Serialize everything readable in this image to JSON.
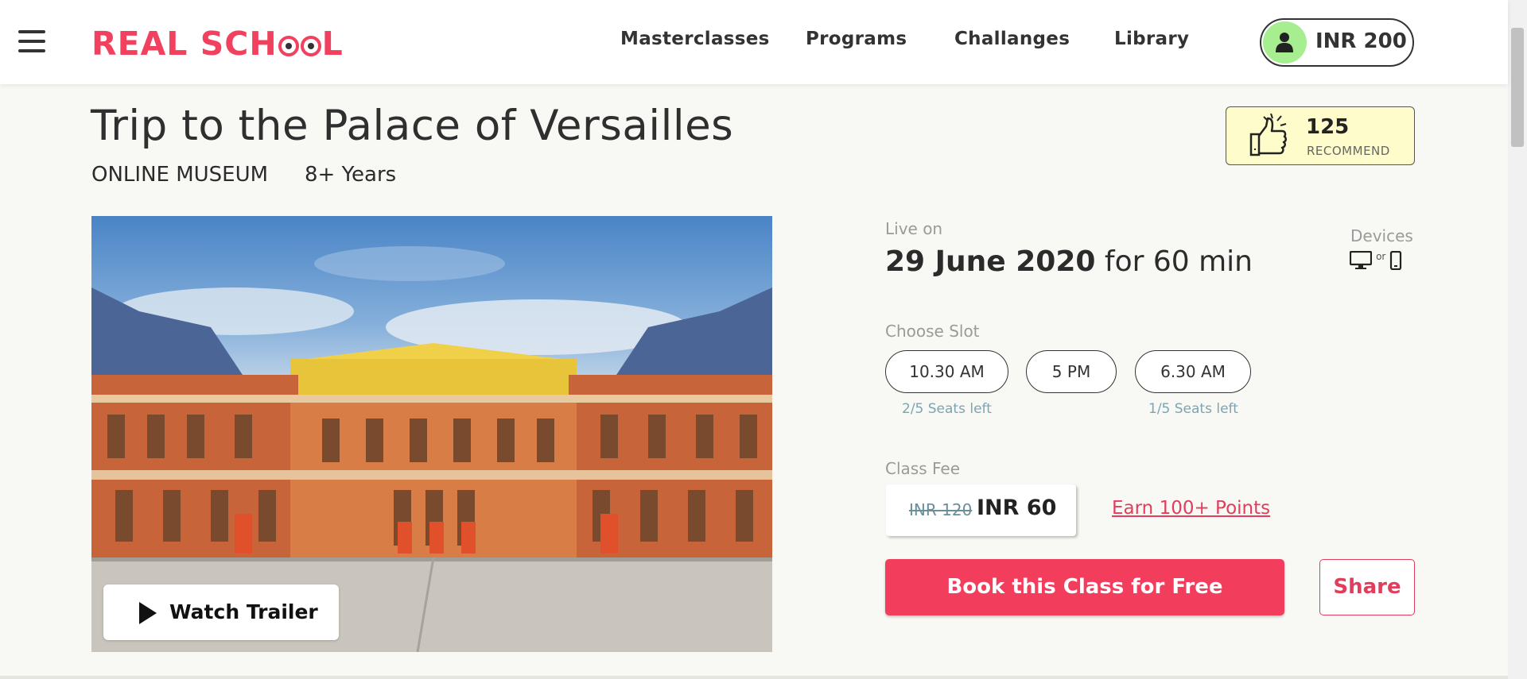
{
  "header": {
    "logo_text_a": "REAL SCH",
    "logo_text_b": "L",
    "nav": [
      "Masterclasses",
      "Programs",
      "Challanges",
      "Library"
    ],
    "wallet_amount": "INR 200"
  },
  "class": {
    "title": "Trip to the Palace of Versailles",
    "category": "ONLINE MUSEUM",
    "age": "8+ Years",
    "recommend_count": "125",
    "recommend_label": "RECOMMEND",
    "trailer_label": "Watch Trailer"
  },
  "schedule": {
    "live_label": "Live on",
    "date": "29 June 2020",
    "duration": "for 60 min",
    "devices_label": "Devices",
    "devices_or": "or",
    "slot_label": "Choose Slot",
    "slots": [
      {
        "time": "10.30 AM",
        "seats": "2/5 Seats left"
      },
      {
        "time": "5 PM",
        "seats": ""
      },
      {
        "time": "6.30 AM",
        "seats": "1/5 Seats left"
      }
    ]
  },
  "fee": {
    "label": "Class Fee",
    "original": "INR 120",
    "price": "INR 60",
    "earn_link": "Earn 100+ Points"
  },
  "actions": {
    "book": "Book this Class for Free",
    "share": "Share"
  },
  "colors": {
    "accent": "#f23d5d",
    "wallet_avatar": "#a6ee8f",
    "recommend_bg": "#fdfcca",
    "seats_text": "#7ea3b2"
  }
}
